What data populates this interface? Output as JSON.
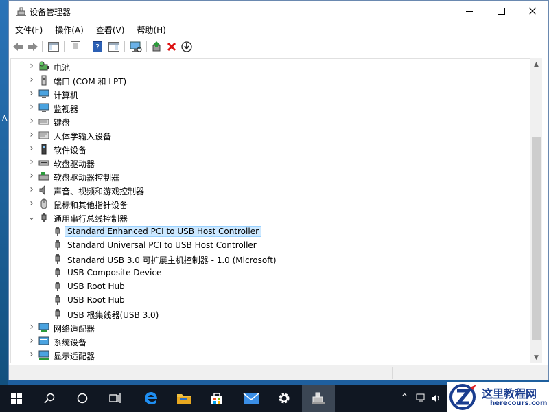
{
  "window": {
    "title": "设备管理器",
    "menu": [
      "文件(F)",
      "操作(A)",
      "查看(V)",
      "帮助(H)"
    ]
  },
  "desktop": {
    "edge_letter": "A"
  },
  "tree": [
    {
      "label": "电池",
      "icon": "battery-icon",
      "expanded": false,
      "level": 0
    },
    {
      "label": "端口 (COM 和 LPT)",
      "icon": "port-icon",
      "expanded": false,
      "level": 0
    },
    {
      "label": "计算机",
      "icon": "computer-icon",
      "expanded": false,
      "level": 0
    },
    {
      "label": "监视器",
      "icon": "monitor-icon",
      "expanded": false,
      "level": 0
    },
    {
      "label": "键盘",
      "icon": "keyboard-icon",
      "expanded": false,
      "level": 0
    },
    {
      "label": "人体学输入设备",
      "icon": "hid-icon",
      "expanded": false,
      "level": 0
    },
    {
      "label": "软件设备",
      "icon": "software-device-icon",
      "expanded": false,
      "level": 0
    },
    {
      "label": "软盘驱动器",
      "icon": "floppy-drive-icon",
      "expanded": false,
      "level": 0
    },
    {
      "label": "软盘驱动器控制器",
      "icon": "floppy-controller-icon",
      "expanded": false,
      "level": 0
    },
    {
      "label": "声音、视频和游戏控制器",
      "icon": "sound-icon",
      "expanded": false,
      "level": 0
    },
    {
      "label": "鼠标和其他指针设备",
      "icon": "mouse-icon",
      "expanded": false,
      "level": 0
    },
    {
      "label": "通用串行总线控制器",
      "icon": "usb-icon",
      "expanded": true,
      "level": 0
    },
    {
      "label": "Standard Enhanced PCI to USB Host Controller",
      "icon": "usb-icon",
      "level": 1,
      "selected": true
    },
    {
      "label": "Standard Universal PCI to USB Host Controller",
      "icon": "usb-icon",
      "level": 1
    },
    {
      "label": "Standard USB 3.0 可扩展主机控制器 - 1.0 (Microsoft)",
      "icon": "usb-icon",
      "level": 1
    },
    {
      "label": "USB Composite Device",
      "icon": "usb-icon",
      "level": 1
    },
    {
      "label": "USB Root Hub",
      "icon": "usb-icon",
      "level": 1
    },
    {
      "label": "USB Root Hub",
      "icon": "usb-icon",
      "level": 1
    },
    {
      "label": "USB 根集线器(USB 3.0)",
      "icon": "usb-icon",
      "level": 1
    },
    {
      "label": "网络适配器",
      "icon": "network-icon",
      "expanded": false,
      "level": 0
    },
    {
      "label": "系统设备",
      "icon": "system-device-icon",
      "expanded": false,
      "level": 0
    },
    {
      "label": "显示适配器",
      "icon": "display-adapter-icon",
      "expanded": false,
      "level": 0
    }
  ],
  "watermark": {
    "text": "这里教程网",
    "url": "herecours.com"
  },
  "colors": {
    "selection": "#cce8ff",
    "taskbar": "#101722",
    "accent": "#0078d7"
  }
}
